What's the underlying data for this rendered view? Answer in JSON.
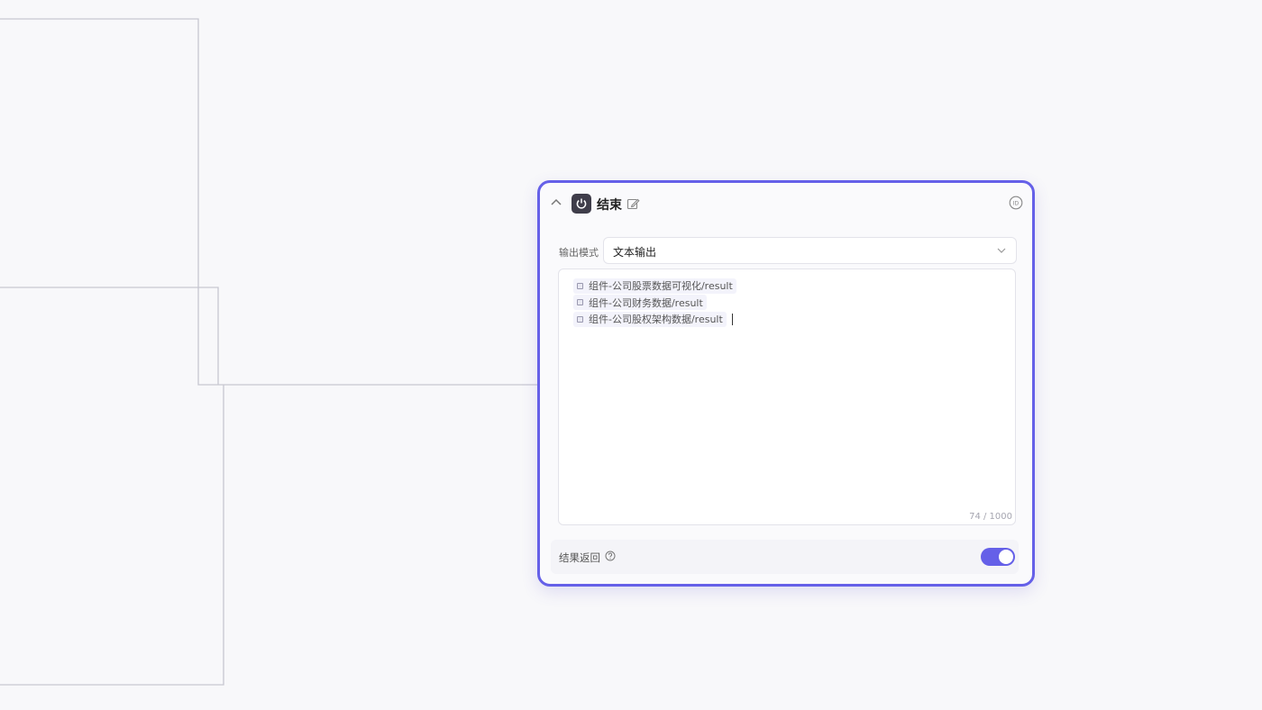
{
  "theme": {
    "accent": "#6560e8",
    "edge": "#c7c7d1",
    "canvas": "#f8f8fa"
  },
  "node": {
    "title": "结束",
    "icon": "power-icon",
    "output_mode": {
      "label": "输出模式",
      "value": "文本输出"
    },
    "editor": {
      "variables": [
        {
          "text": "组件-公司股票数据可视化/result"
        },
        {
          "text": "组件-公司财务数据/result"
        },
        {
          "text": "组件-公司股权架构数据/result"
        }
      ],
      "char_count": "74 / 1000"
    },
    "result_return": {
      "label": "结果返回",
      "enabled": true
    }
  }
}
